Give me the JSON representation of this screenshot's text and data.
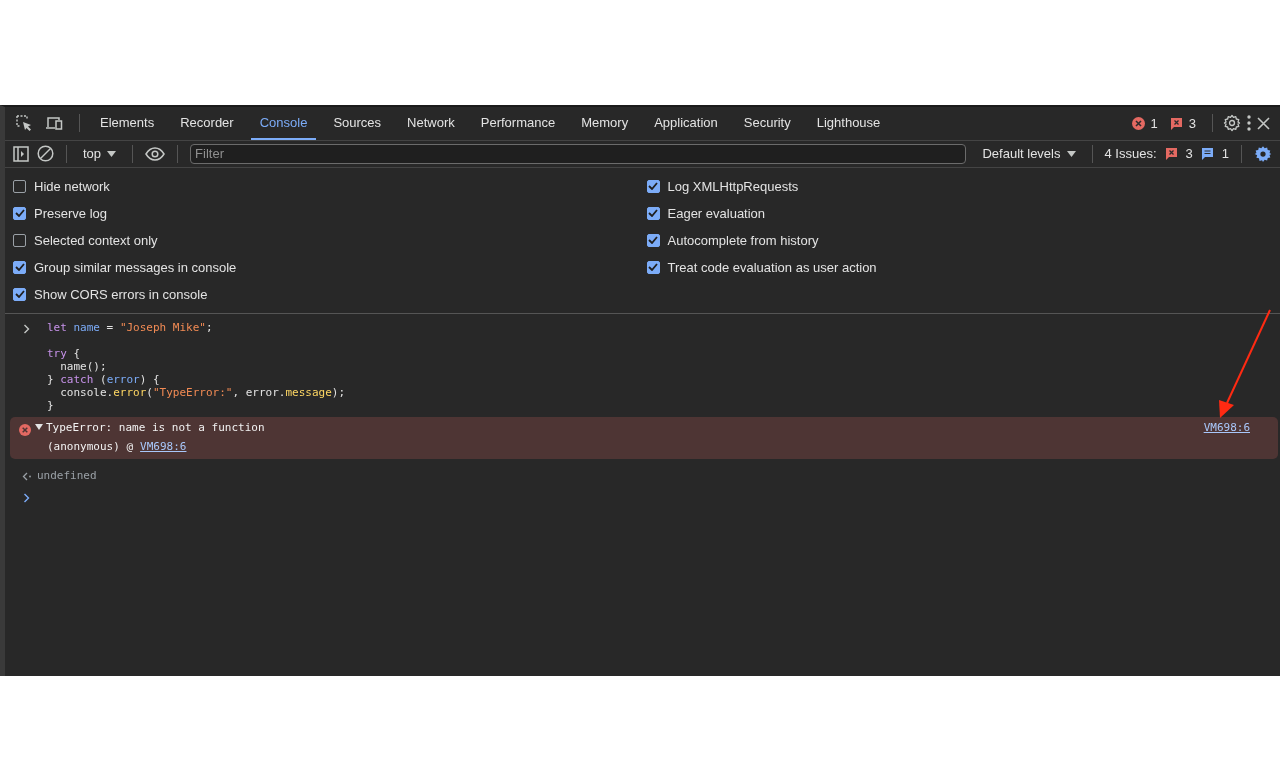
{
  "tabs": [
    {
      "label": "Elements",
      "selected": false
    },
    {
      "label": "Recorder",
      "selected": false
    },
    {
      "label": "Console",
      "selected": true
    },
    {
      "label": "Sources",
      "selected": false
    },
    {
      "label": "Network",
      "selected": false
    },
    {
      "label": "Performance",
      "selected": false
    },
    {
      "label": "Memory",
      "selected": false
    },
    {
      "label": "Application",
      "selected": false
    },
    {
      "label": "Security",
      "selected": false
    },
    {
      "label": "Lighthouse",
      "selected": false
    }
  ],
  "counters": {
    "errors": "1",
    "warnings": "3"
  },
  "console_toolbar": {
    "context": "top",
    "filter": {
      "placeholder": "Filter"
    },
    "levels": "Default levels",
    "issues_label": "4 Issues:",
    "issues_warnings": "3",
    "issues_info": "1"
  },
  "settings": {
    "left": [
      {
        "label": "Hide network",
        "checked": false
      },
      {
        "label": "Preserve log",
        "checked": true
      },
      {
        "label": "Selected context only",
        "checked": false
      },
      {
        "label": "Group similar messages in console",
        "checked": true
      },
      {
        "label": "Show CORS errors in console",
        "checked": true
      }
    ],
    "right": [
      {
        "label": "Log XMLHttpRequests",
        "checked": true
      },
      {
        "label": "Eager evaluation",
        "checked": true
      },
      {
        "label": "Autocomplete from history",
        "checked": true
      },
      {
        "label": "Treat code evaluation as user action",
        "checked": true
      }
    ]
  },
  "console": [
    {
      "kind": "input",
      "blocks": [
        [
          [
            {
              "kind": "keyword",
              "text": "let "
            },
            {
              "kind": "variable",
              "text": "name"
            },
            {
              "kind": "plain",
              "text": " = "
            },
            {
              "kind": "string",
              "text": "\"Joseph Mike\""
            },
            {
              "kind": "plain",
              "text": ";"
            }
          ]
        ],
        [
          [
            {
              "kind": "keyword",
              "text": "try"
            },
            {
              "kind": "plain",
              "text": " {"
            }
          ],
          [
            {
              "kind": "plain",
              "text": "  name();"
            }
          ],
          [
            {
              "kind": "plain",
              "text": "} "
            },
            {
              "kind": "keyword",
              "text": "catch"
            },
            {
              "kind": "plain",
              "text": " ("
            },
            {
              "kind": "variable",
              "text": "error"
            },
            {
              "kind": "plain",
              "text": ") {"
            }
          ],
          [
            {
              "kind": "plain",
              "text": "  console."
            },
            {
              "kind": "method",
              "text": "error"
            },
            {
              "kind": "plain",
              "text": "("
            },
            {
              "kind": "string",
              "text": "\"TypeError:\""
            },
            {
              "kind": "plain",
              "text": ", error."
            },
            {
              "kind": "method",
              "text": "message"
            },
            {
              "kind": "plain",
              "text": ");"
            }
          ],
          [
            {
              "kind": "plain",
              "text": "}"
            }
          ]
        ]
      ]
    },
    {
      "kind": "error",
      "message": "TypeError: name is not a function",
      "expanded": true,
      "stack": "(anonymous) @",
      "stack_link": "VM698:6",
      "source": "VM698:6"
    },
    {
      "kind": "result",
      "text": "undefined"
    }
  ]
}
